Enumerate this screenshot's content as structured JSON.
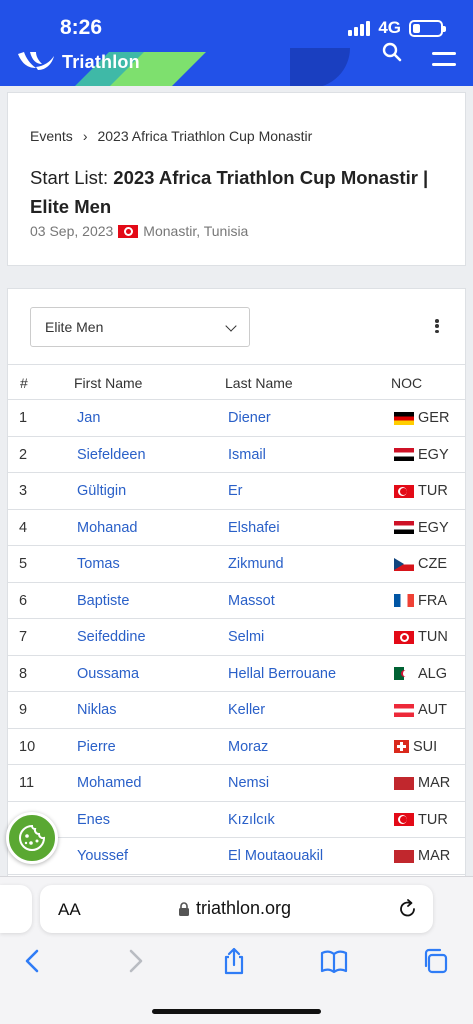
{
  "status_bar": {
    "time": "8:26",
    "network": "4G"
  },
  "header": {
    "brand": "Triathlon"
  },
  "event": {
    "breadcrumb": [
      "Events",
      "›",
      "2023 Africa Triathlon Cup Monastir"
    ],
    "title_prefix": "Start List:",
    "title_main": "2023 Africa Triathlon Cup Monastir | Elite Men",
    "date": "03 Sep, 2023",
    "location": "Monastir, Tunisia"
  },
  "start_list": {
    "selected_program": "Elite Men",
    "columns": [
      "#",
      "First Name",
      "Last Name",
      "NOC"
    ],
    "rows": [
      {
        "num": "1",
        "first": "Jan",
        "last": "Diener",
        "noc": "GER"
      },
      {
        "num": "2",
        "first": "Siefeldeen",
        "last": "Ismail",
        "noc": "EGY"
      },
      {
        "num": "3",
        "first": "Gültigin",
        "last": "Er",
        "noc": "TUR"
      },
      {
        "num": "4",
        "first": "Mohanad",
        "last": "Elshafei",
        "noc": "EGY"
      },
      {
        "num": "5",
        "first": "Tomas",
        "last": "Zikmund",
        "noc": "CZE"
      },
      {
        "num": "6",
        "first": "Baptiste",
        "last": "Massot",
        "noc": "FRA"
      },
      {
        "num": "7",
        "first": "Seifeddine",
        "last": "Selmi",
        "noc": "TUN"
      },
      {
        "num": "8",
        "first": "Oussama",
        "last": "Hellal Berrouane",
        "noc": "ALG"
      },
      {
        "num": "9",
        "first": "Niklas",
        "last": "Keller",
        "noc": "AUT"
      },
      {
        "num": "10",
        "first": "Pierre",
        "last": "Moraz",
        "noc": "SUI"
      },
      {
        "num": "11",
        "first": "Mohamed",
        "last": "Nemsi",
        "noc": "MAR"
      },
      {
        "num": "",
        "first": "Enes",
        "last": "Kızılcık",
        "noc": "TUR"
      },
      {
        "num": "",
        "first": "Youssef",
        "last": "El Moutaouakil",
        "noc": "MAR"
      }
    ]
  },
  "browser": {
    "aa_label": "AA",
    "url": "triathlon.org"
  },
  "colors": {
    "brand_blue": "#2251e8",
    "link_blue": "#2a60c8",
    "cookie_green": "#5aa832"
  }
}
